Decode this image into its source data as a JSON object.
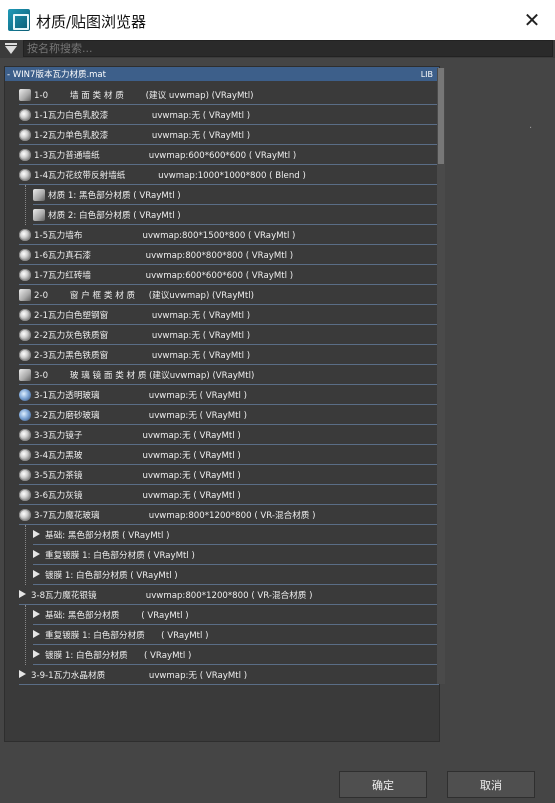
{
  "window": {
    "title": "材质/贴图浏览器"
  },
  "search": {
    "placeholder": "按名称搜索..."
  },
  "library": {
    "name": "- WIN7版本瓦力材质.mat",
    "tag": "LIB"
  },
  "rows": [
    {
      "icon": "sq",
      "label": "1-0        墙 面 类 材 质        (建议 uvwmap) (VRayMtl)"
    },
    {
      "icon": "gear",
      "label": "1-1瓦力白色乳胶漆                uvwmap:无 ( VRayMtl )"
    },
    {
      "icon": "gear",
      "label": "1-2瓦力单色乳胶漆                uvwmap:无 ( VRayMtl )"
    },
    {
      "icon": "gear",
      "label": "1-3瓦力普通墙纸                  uvwmap:600*600*600 ( VRayMtl )"
    },
    {
      "icon": "gear",
      "label": "1-4瓦力花纹带反射墙纸            uvwmap:1000*1000*800 ( Blend )"
    },
    {
      "icon": "sq",
      "label": "材质 1: 黑色部分材质 ( VRayMtl )"
    },
    {
      "icon": "sq",
      "label": "材质 2: 白色部分材质 ( VRayMtl )"
    },
    {
      "icon": "gear",
      "label": "1-5瓦力墙布                      uvwmap:800*1500*800 ( VRayMtl )"
    },
    {
      "icon": "gear",
      "label": "1-6瓦力真石漆                    uvwmap:800*800*800 ( VRayMtl )"
    },
    {
      "icon": "gear",
      "label": "1-7瓦力红砖墙                    uvwmap:600*600*600 ( VRayMtl )"
    },
    {
      "icon": "sq",
      "label": "2-0        窗 户 框 类 材 质     (建议uvwmap) (VRayMtl)"
    },
    {
      "icon": "gear",
      "label": "2-1瓦力白色塑钢窗                uvwmap:无 ( VRayMtl )"
    },
    {
      "icon": "gear",
      "label": "2-2瓦力灰色铁质窗                uvwmap:无 ( VRayMtl )"
    },
    {
      "icon": "gear",
      "label": "2-3瓦力黑色铁质窗                uvwmap:无 ( VRayMtl )"
    },
    {
      "icon": "sq",
      "label": "3-0        玻 璃 镜 面 类 材 质 (建议uvwmap) (VRayMtl)"
    },
    {
      "icon": "blue",
      "label": "3-1瓦力透明玻璃                  uvwmap:无 ( VRayMtl )"
    },
    {
      "icon": "blue",
      "label": "3-2瓦力磨砂玻璃                  uvwmap:无 ( VRayMtl )"
    },
    {
      "icon": "gear",
      "label": "3-3瓦力镜子                      uvwmap:无 ( VRayMtl )"
    },
    {
      "icon": "gear",
      "label": "3-4瓦力黑玻                      uvwmap:无 ( VRayMtl )"
    },
    {
      "icon": "gear",
      "label": "3-5瓦力茶镜                      uvwmap:无 ( VRayMtl )"
    },
    {
      "icon": "gear",
      "label": "3-6瓦力灰镜                      uvwmap:无 ( VRayMtl )"
    },
    {
      "icon": "gear",
      "label": "3-7瓦力魔花玻璃                  uvwmap:800*1200*800 ( VR-混合材质 )"
    },
    {
      "icon": "sub",
      "label": "基础: 黑色部分材质 ( VRayMtl )"
    },
    {
      "icon": "sub",
      "label": "重复镀膜 1: 白色部分材质 ( VRayMtl )"
    },
    {
      "icon": "sub",
      "label": "镀膜 1: 白色部分材质 ( VRayMtl )"
    },
    {
      "icon": "sub",
      "label": "3-8瓦力魔花银镜                  uvwmap:800*1200*800 ( VR-混合材质 )"
    },
    {
      "icon": "sub",
      "label": "基础: 黑色部分材质        ( VRayMtl )"
    },
    {
      "icon": "sub",
      "label": "重复镀膜 1: 白色部分材质      ( VRayMtl )"
    },
    {
      "icon": "sub",
      "label": "镀膜 1: 白色部分材质      ( VRayMtl )"
    },
    {
      "icon": "sub",
      "label": "3-9-1瓦力水晶材质                uvwmap:无 ( VRayMtl )"
    }
  ],
  "buttons": {
    "ok": "确定",
    "cancel": "取消"
  }
}
